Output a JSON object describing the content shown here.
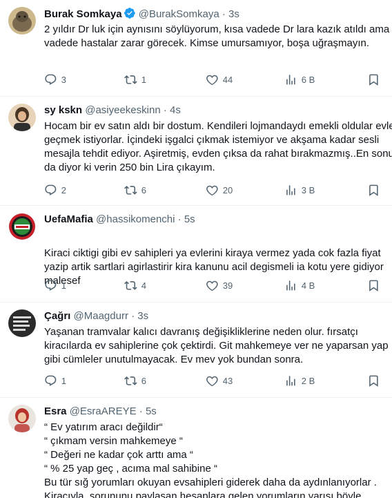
{
  "tweets": [
    {
      "name": "Burak Somkaya",
      "verified": true,
      "handle": "@BurakSomkaya",
      "dot": "·",
      "time": "3s",
      "text": "2 yıldır Dr luk için aynısını söylüyorum, kısa vadede Dr lara kazık atıldı ama uzun vadede hastalar zarar görecek. Kimse umursamıyor, boşa uğraşmayın.",
      "replies": "3",
      "retweets": "1",
      "likes": "44",
      "views": "6 B",
      "avatar_color": "#9a8a6a"
    },
    {
      "name": "sy kskn",
      "verified": false,
      "handle": "@asiyeekeskinn",
      "dot": "·",
      "time": "4s",
      "text": "Hocam bir ev satın aldı bir dostum. Kendileri lojmandaydı emekli oldular evlerine geçmek istiyorlar. İçindeki işgalci çıkmak istemiyor ve akşama kadar sesli mesajla tehdit ediyor. Aşiretmiş, evden çıksa da rahat bırakmazmış..En sonunda da diyor ki verin 250 bin Lira çıkayım.",
      "replies": "2",
      "retweets": "6",
      "likes": "20",
      "views": "3 B",
      "avatar_color": "#c9a37a"
    },
    {
      "name": "UefaMafia",
      "verified": false,
      "handle": "@hassikomenchi",
      "dot": "·",
      "time": "5s",
      "text": "Kiraci ciktigi gibi ev sahipleri ya evlerini kiraya vermez yada cok fazla fiyat yazip artik sartlari agirlastirir kira kanunu acil degismeli ia kotu yere gidiyor malesef",
      "replies": "1",
      "retweets": "4",
      "likes": "39",
      "views": "4 B",
      "avatar_color": "#c8202a"
    },
    {
      "name": "Çağrı",
      "verified": false,
      "handle": "@Maagdurr",
      "dot": "·",
      "time": "3s",
      "text": "Yaşanan tramvalar kalıcı davranış değişikliklerine neden olur. fırsatçı kiracılarda ev sahiplerine çok çektirdi. Git mahkemeye ver ne yaparsan yap gibi cümleler unutulmayacak. Ev mev yok bundan sonra.",
      "replies": "1",
      "retweets": "6",
      "likes": "43",
      "views": "2 B",
      "avatar_color": "#2b2b2b"
    },
    {
      "name": "Esra",
      "verified": false,
      "handle": "@EsraAREYE",
      "dot": "·",
      "time": "5s",
      "text": "“ Ev yatırım aracı değildir“\n“ çıkmam versin  mahkemeye “\n“ Değeri ne kadar çok arttı ama “\n“ % 25 yap geç , acıma mal sahibine “\nBu tür sığ yorumları okuyan evsahipleri giderek daha da aydınlanıyorlar .\nKiracıyla, sorununu paylaşan hesaplara gelen yorumların yarısı böyle",
      "replies": "",
      "retweets": "",
      "likes": "",
      "views": "",
      "avatar_color": "#c2554f"
    }
  ]
}
